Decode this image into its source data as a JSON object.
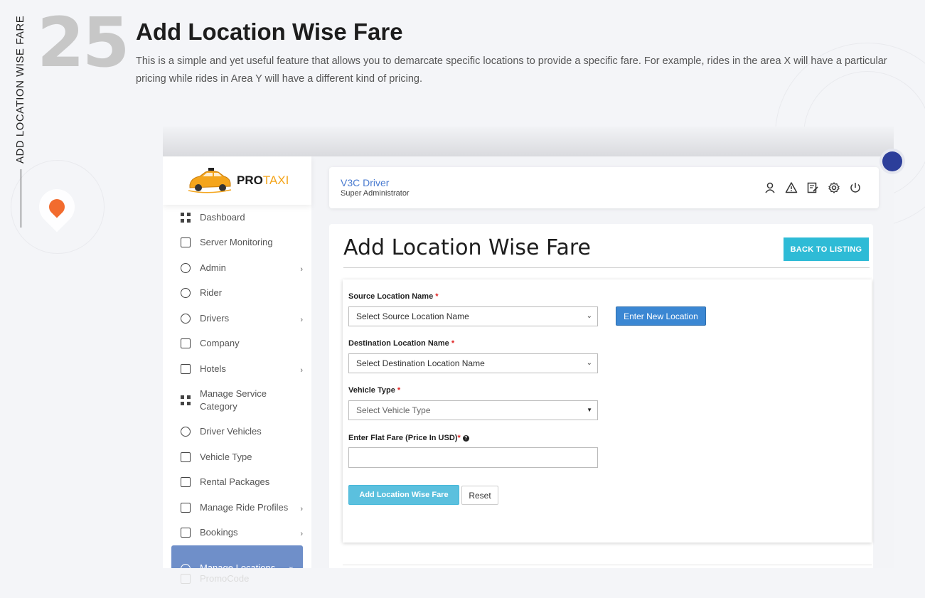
{
  "feature": {
    "number": "25",
    "vertical_label": "ADD LOCATION WISE FARE",
    "title": "Add Location Wise Fare",
    "description": "This is a simple and yet useful feature that allows you to demarcate specific locations to provide a specific fare. For example, rides in the area X will have a particular pricing while rides in Area Y will have a different kind of pricing."
  },
  "brand": {
    "name_dark": "PRO",
    "name_accent": "TAXI"
  },
  "sidebar": {
    "items": [
      {
        "label": "Dashboard",
        "icon": "dashboard-icon",
        "has_children": false
      },
      {
        "label": "Server Monitoring",
        "icon": "chart-icon",
        "has_children": false
      },
      {
        "label": "Admin",
        "icon": "user-lock-icon",
        "has_children": true
      },
      {
        "label": "Rider",
        "icon": "group-icon",
        "has_children": false
      },
      {
        "label": "Drivers",
        "icon": "driver-icon",
        "has_children": true
      },
      {
        "label": "Company",
        "icon": "building-icon",
        "has_children": false
      },
      {
        "label": "Hotels",
        "icon": "hotel-icon",
        "has_children": true
      },
      {
        "label": "Manage Service Category",
        "icon": "grid-icon",
        "has_children": false
      },
      {
        "label": "Driver Vehicles",
        "icon": "steering-wheel-icon",
        "has_children": false
      },
      {
        "label": "Vehicle Type",
        "icon": "car-icon",
        "has_children": false
      },
      {
        "label": "Rental Packages",
        "icon": "package-icon",
        "has_children": false
      },
      {
        "label": "Manage Ride Profiles",
        "icon": "briefcase-icon",
        "has_children": true
      },
      {
        "label": "Bookings",
        "icon": "list-icon",
        "has_children": true
      },
      {
        "label": "Manage Locations",
        "icon": "location-icon",
        "has_children": true,
        "active": true
      }
    ],
    "faded_item": "PromoCode"
  },
  "header": {
    "user_name": "V3C Driver",
    "user_role": "Super Administrator",
    "icons": [
      "user-icon",
      "alert-icon",
      "edit-icon",
      "settings-icon",
      "power-icon"
    ]
  },
  "page": {
    "title": "Add Location Wise Fare",
    "back_button": "BACK TO LISTING"
  },
  "form": {
    "source_label": "Source Location Name",
    "source_placeholder": "Select Source Location Name",
    "new_location_button": "Enter New Location",
    "destination_label": "Destination Location Name",
    "destination_placeholder": "Select Destination Location Name",
    "vehicle_label": "Vehicle Type",
    "vehicle_placeholder": "Select Vehicle Type",
    "fare_label": "Enter Flat Fare (Price In USD)",
    "required_marker": "*",
    "help_glyph": "?",
    "submit_button": "Add Location Wise Fare",
    "reset_button": "Reset"
  },
  "colors": {
    "accent_cyan": "#2ebbd6",
    "primary_blue": "#3b87d3",
    "active_menu": "#6f8fc9",
    "brand_orange": "#f4a51c"
  }
}
